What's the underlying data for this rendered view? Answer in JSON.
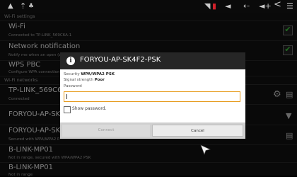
{
  "statusbar": {
    "left_icons": [
      "home-icon",
      "up-arrows-icon",
      "usb-icon"
    ],
    "right_icons": [
      "wifi-icon",
      "battery-icon",
      "volume-down-icon",
      "back-icon",
      "volume-up-icon",
      "share-icon",
      "menu-icon"
    ],
    "glyphs": {
      "home": "▲",
      "up": "⇡",
      "usb": "♣",
      "wifi": "◥",
      "battery": "▮",
      "voldown": "◄",
      "back": "⇠",
      "volup": "◄+",
      "share": "<",
      "menu": "☰"
    }
  },
  "sections": {
    "wifi_settings": "Wi-Fi settings",
    "wifi_networks": "Wi-Fi networks"
  },
  "wifi": {
    "title": "Wi-Fi",
    "subtitle": "Connected to TP-LINK_569C6A-1",
    "checked": true
  },
  "network_notification": {
    "title": "Network notification",
    "subtitle": "Notify me when an open (w",
    "checked": true
  },
  "wps": {
    "title": "WPS PBC",
    "subtitle": "Configure WPA connection"
  },
  "networks": [
    {
      "name": "TP-LINK_569C6A-1",
      "status": "Connected"
    },
    {
      "name": "FORYOU-AP-SK4F2",
      "status": ""
    },
    {
      "name": "FORYOU-AP-SK4F2",
      "status": "Secured with WPA/WPA2 P"
    },
    {
      "name": "B-LINK-MP01",
      "status": "Not in range, secured with WPA/WPA2 PSK"
    },
    {
      "name": "B-LINK-MP01",
      "status": "Not in range"
    }
  ],
  "dialog": {
    "title": "FORYOU-AP-SK4F2-PSK",
    "security_label": "Security",
    "security_value": "WPA/WPA2 PSK",
    "signal_label": "Signal strength",
    "signal_value": "Poor",
    "password_label": "Password",
    "password_value": "",
    "show_password_label": "Show password.",
    "connect_label": "Connect",
    "cancel_label": "Cancel"
  },
  "colors": {
    "checkbox_tick": "#3fbf3f",
    "input_focus": "#e69a1a",
    "title_bar": "#262626"
  }
}
